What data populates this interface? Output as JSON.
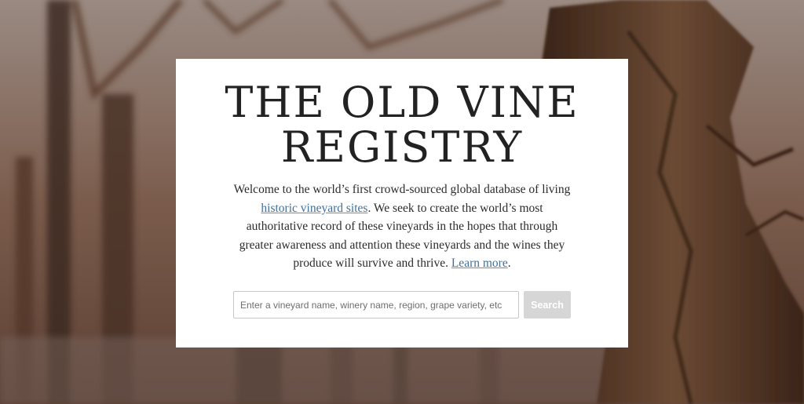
{
  "hero": {
    "title_line1": "THE OLD VINE",
    "title_line2": "REGISTRY",
    "intro_text_1": "Welcome to the world’s first crowd-sourced global database of living ",
    "intro_link_1": "historic vineyard sites",
    "intro_text_2": ". We seek to create the world’s most authoritative record of these vineyards in the hopes that through greater awareness and attention these vineyards and the wines they produce will survive and thrive. ",
    "intro_link_2": "Learn more",
    "intro_text_3": "."
  },
  "search": {
    "placeholder": "Enter a vineyard name, winery name, region, grape variety, etc",
    "value": "",
    "button_label": "Search"
  },
  "colors": {
    "link": "#3f6f9a",
    "button_bg": "#d6d6d6",
    "card_bg": "#ffffff",
    "title": "#222222"
  }
}
